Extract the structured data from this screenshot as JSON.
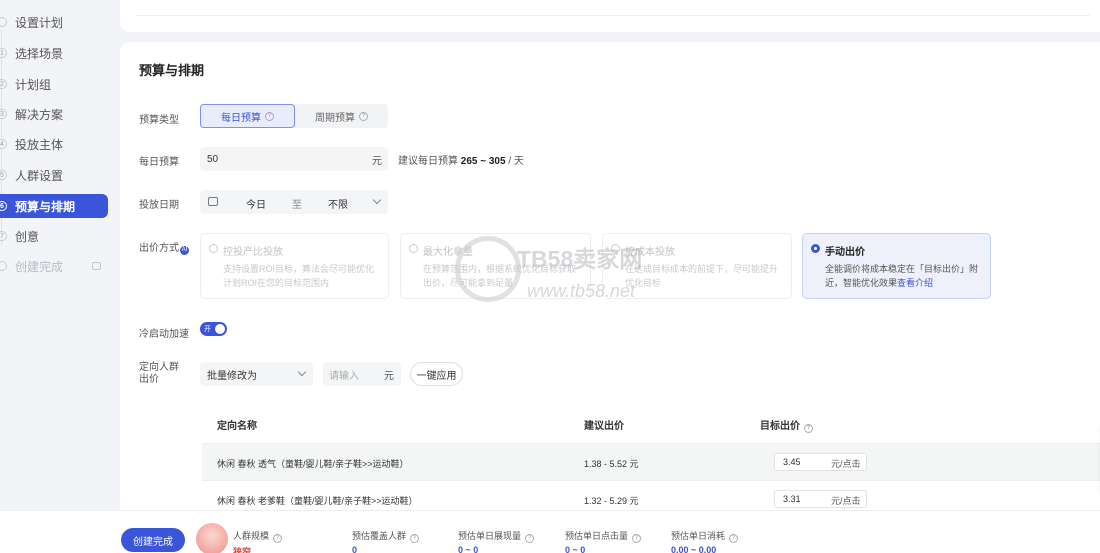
{
  "sidebar": {
    "steps": [
      {
        "num": "",
        "label": "设置计划"
      },
      {
        "num": "1",
        "label": "选择场景"
      },
      {
        "num": "2",
        "label": "计划组"
      },
      {
        "num": "3",
        "label": "解决方案"
      },
      {
        "num": "4",
        "label": "投放主体"
      },
      {
        "num": "5",
        "label": "人群设置"
      },
      {
        "num": "6",
        "label": "预算与排期"
      },
      {
        "num": "7",
        "label": "创意"
      },
      {
        "num": "",
        "label": "创建完成"
      }
    ]
  },
  "section": {
    "title": "预算与排期"
  },
  "budget_type": {
    "label": "预算类型",
    "options": [
      "每日预算",
      "周期预算"
    ],
    "selected": "每日预算"
  },
  "daily_budget": {
    "label": "每日预算",
    "value": "50",
    "unit": "元",
    "suggest_prefix": "建议每日预算",
    "suggest_range": "265 ~ 305",
    "suggest_suffix": "/ 天"
  },
  "schedule": {
    "label": "投放日期",
    "start": "今日",
    "sep": "至",
    "end": "不限"
  },
  "bid_method": {
    "label": "出价方式",
    "ai_badge": "AI",
    "options": [
      {
        "title": "控投产比投放",
        "desc": "支持设置ROI目标，算法会尽可能优化计划ROI在您的目标范围内"
      },
      {
        "title": "最大化拿量",
        "desc": "在预算范围内，根据系统优化目标获取出价，尽可能拿到足量"
      },
      {
        "title": "控成本投放",
        "desc": "在达成目标成本的前提下，尽可能提升优化目标"
      },
      {
        "title": "手动出价",
        "desc": "全能调价将成本稳定在「目标出价」附近，智能优化效果",
        "link": "查看介绍"
      }
    ],
    "selected": "手动出价"
  },
  "cold_start": {
    "label": "冷启动加速",
    "toggle_text": "开",
    "on": true
  },
  "crowd_bid": {
    "label": "定向人群出价",
    "batch_select": "批量修改为",
    "input_placeholder": "请输入",
    "unit": "元",
    "apply_label": "一键应用"
  },
  "table": {
    "headers": [
      "定向名称",
      "建议出价",
      "目标出价"
    ],
    "rows": [
      {
        "name": "休闲 春秋 透气（童鞋/婴儿鞋/亲子鞋>>运动鞋）",
        "suggest": "1.38 - 5.52 元",
        "bid": "3.45",
        "unit": "元/点击"
      },
      {
        "name": "休闲 春秋 老爹鞋（童鞋/婴儿鞋/亲子鞋>>运动鞋）",
        "suggest": "1.32 - 5.29 元",
        "bid": "3.31",
        "unit": "元/点击"
      }
    ]
  },
  "watermark": {
    "title": "TB58卖家网",
    "url": "www.tb58.net"
  },
  "footer": {
    "create_label": "创建完成",
    "stats": [
      {
        "label": "人群规模",
        "value": "狭窄"
      },
      {
        "label": "预估覆盖人群",
        "value": "0"
      },
      {
        "label": "预估单日展现量",
        "value": "0 ~ 0"
      },
      {
        "label": "预估单日点击量",
        "value": "0 ~ 0"
      },
      {
        "label": "预估单日消耗",
        "value": "0.00 ~ 0.00"
      }
    ]
  },
  "colors": {
    "accent": "#3a55d9",
    "warning": "#e04a3a"
  }
}
